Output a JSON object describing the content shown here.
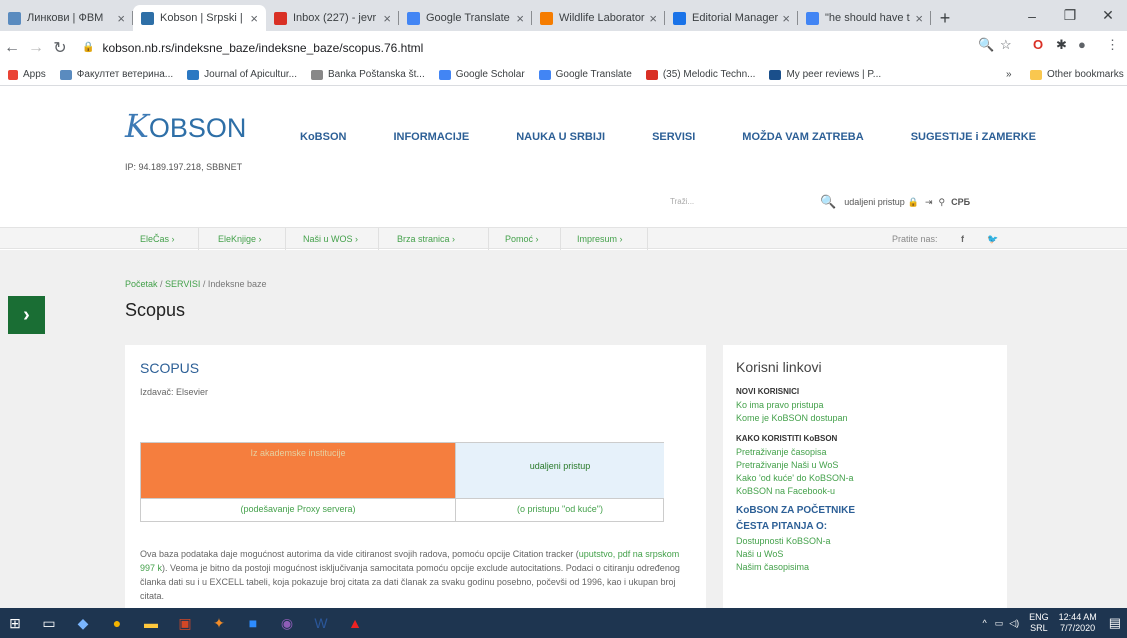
{
  "browser": {
    "tabs": [
      {
        "label": "Линкови | ФВМ",
        "favicon_color": "#5a8bbf"
      },
      {
        "label": "Kobson | Srpski | S",
        "favicon_color": "#2e6fa7"
      },
      {
        "label": "Inbox (227) - jevr",
        "favicon_color": "#d93025"
      },
      {
        "label": "Google Translate",
        "favicon_color": "#4285f4"
      },
      {
        "label": "Wildlife Laborator",
        "favicon_color": "#f57c00"
      },
      {
        "label": "Editorial Manager",
        "favicon_color": "#1a73e8"
      },
      {
        "label": "\"he should have t",
        "favicon_color": "#4285f4"
      }
    ],
    "new_tab": "+",
    "window_controls": [
      "–",
      "❐",
      "✕"
    ],
    "url": "kobson.nb.rs/indeksne_baze/indeksne_baze/scopus.76.html",
    "bookmarks": [
      {
        "label": "Apps",
        "color": "#3c4043"
      },
      {
        "label": "Факултет ветерина...",
        "color": "#5a8bbf"
      },
      {
        "label": "Journal of Apicultur...",
        "color": "#2b78c2"
      },
      {
        "label": "Banka Poštanska št...",
        "color": "#888"
      },
      {
        "label": "Google Scholar",
        "color": "#4285f4"
      },
      {
        "label": "Google Translate",
        "color": "#4285f4"
      },
      {
        "label": "(35) Melodic Techn...",
        "color": "#d93025"
      },
      {
        "label": "My peer reviews | P...",
        "color": "#1a4f8b"
      }
    ],
    "bookmarks_more": "»",
    "other_bookmarks": "Other bookmarks"
  },
  "site": {
    "logo_k": "K",
    "logo_rest": "OBSON",
    "ip": "IP: 94.189.197.218, SBBNET",
    "nav": [
      "KoBSON",
      "INFORMACIJE",
      "NAUKA U SRBIJI",
      "SERVISI",
      "MOŽDA VAM ZATREBA",
      "SUGESTIJE i ZAMERKE"
    ],
    "search_placeholder": "Traži...",
    "remote_access": "udaljeni pristup",
    "lang": "СРБ",
    "subnav": [
      "ElеČas ›",
      "EleKnjige ›",
      "Naši u WOS ›",
      "Brza stranica ›",
      "Pomoć ›",
      "Impresum ›"
    ],
    "follow": "Pratite nas:",
    "social": [
      "f",
      "🐦"
    ]
  },
  "page": {
    "crumb": [
      "Početak",
      "SERVISI",
      "Indeksne baze"
    ],
    "title": "Scopus",
    "card_title": "SCOPUS",
    "publisher": "Izdavač: Elsevier",
    "table": {
      "c1": "Iz akademske institucije",
      "c2": "udaljeni pristup",
      "c3": "(podešavanje Proxy servera)",
      "c4": "(o pristupu \"od kuće\")"
    },
    "desc1": "Ova baza podataka daje mogućnost autorima da vide citiranost svojih radova, pomoću opcije Citation tracker (",
    "desc_link": "uputstvo, pdf na srpskom 997 k",
    "desc2": "). Veoma je bitno da postoji mogućnost isključivanja samocitata pomoću opcije exclude autocitations. Podaci o citiranju određenog članka dati su i u EXCELL tabeli, koja pokazuje broj citata za dati članak za svaku godinu posebno, počevši od 1996, kao i ukupan broj citata."
  },
  "sidebar": {
    "title": "Korisni linkovi",
    "sec1": "NOVI KORISNICI",
    "sec1_links": [
      "Ko ima pravo pristupa",
      "Kome je KoBSON dostupan"
    ],
    "sec2": "KAKO KORISTITI KoBSON",
    "sec2_links": [
      "Pretraživanje časopisa",
      "Pretraživanje Naši u WoS",
      "Kako 'od kuće' do KoBSON-a",
      "KoBSON na Facebook-u"
    ],
    "big1": "KoBSON ZA POČETNIKE",
    "big2": "ČESTA PITANJA O:",
    "sec3_links": [
      "Dostupnosti KoBSON-a",
      "Naši u WoS",
      "Našim časopisima"
    ]
  },
  "taskbar": {
    "lang": "ENG",
    "region": "SRL",
    "time": "12:44 AM",
    "date": "7/7/2020"
  }
}
